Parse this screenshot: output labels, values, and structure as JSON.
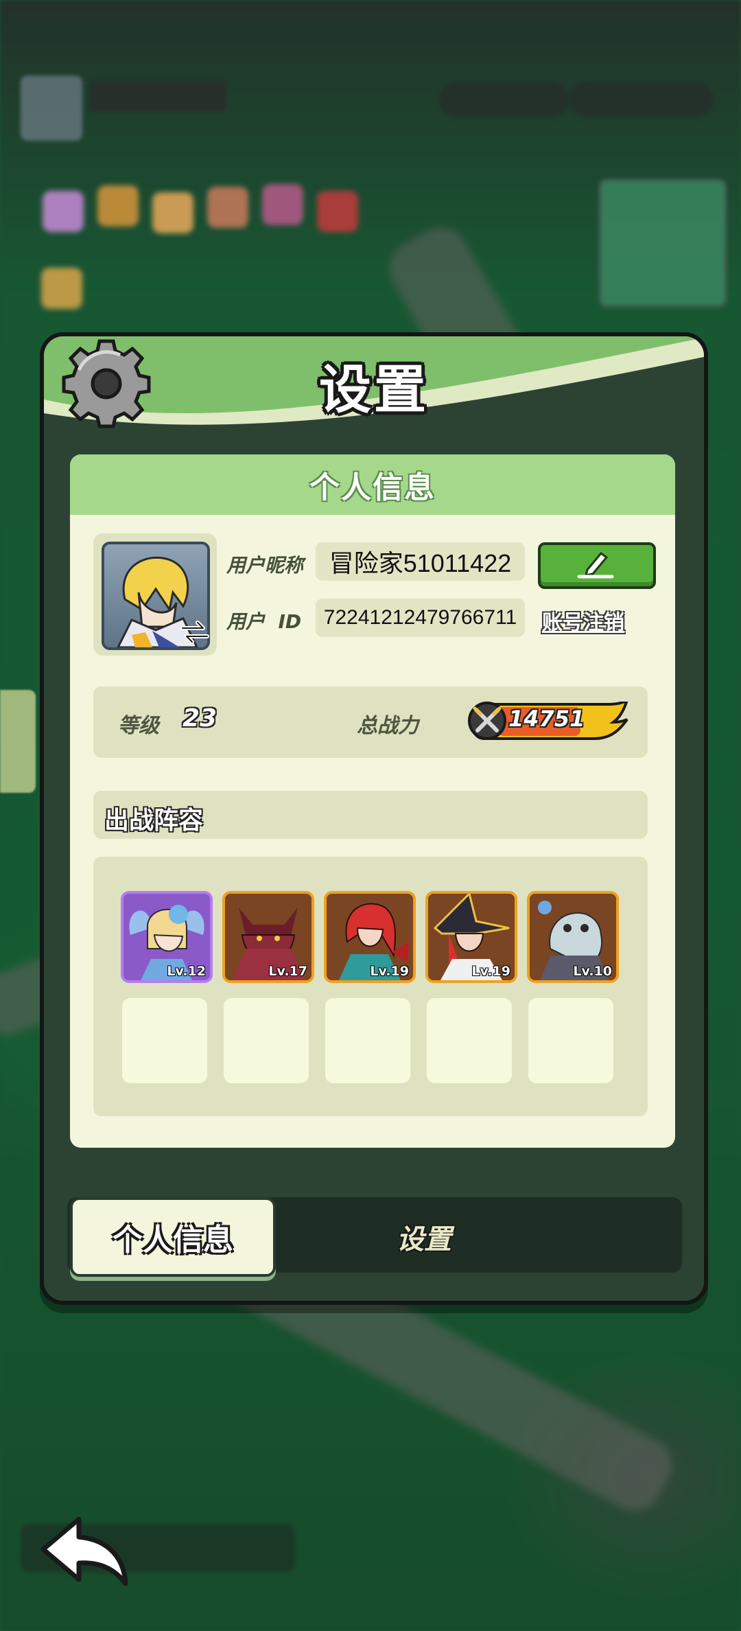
{
  "panel": {
    "title": "设置"
  },
  "card": {
    "title": "个人信息"
  },
  "profile": {
    "nickname_label": "用户昵称",
    "nickname": "冒险家51011422",
    "id_label": "用户  ID",
    "user_id": "72241212479766711",
    "delete_account_label": "账号注销"
  },
  "stats": {
    "level_label": "等级",
    "level": "23",
    "power_label": "总战力",
    "power": "14751"
  },
  "lineup": {
    "title": "出战阵容",
    "heroes": [
      {
        "level": "Lv.12",
        "rarity": "purple"
      },
      {
        "level": "Lv.17",
        "rarity": "orange"
      },
      {
        "level": "Lv.19",
        "rarity": "orange"
      },
      {
        "level": "Lv.19",
        "rarity": "orange"
      },
      {
        "level": "Lv.10",
        "rarity": "orange"
      }
    ]
  },
  "tabs": {
    "active": "个人信息",
    "inactive": "设置"
  },
  "icons": [
    "gear-icon",
    "edit-pencil-icon",
    "swap-arrows-icon",
    "crossed-swords-icon",
    "back-arrow-icon"
  ],
  "colors": {
    "header_green": "#7fbf6b",
    "card_bg": "#f3f6dc",
    "edit_button": "#57b13a",
    "power_pill": "#f2c21a",
    "rarity_purple": "#b77bf0",
    "rarity_orange": "#f0a020"
  }
}
